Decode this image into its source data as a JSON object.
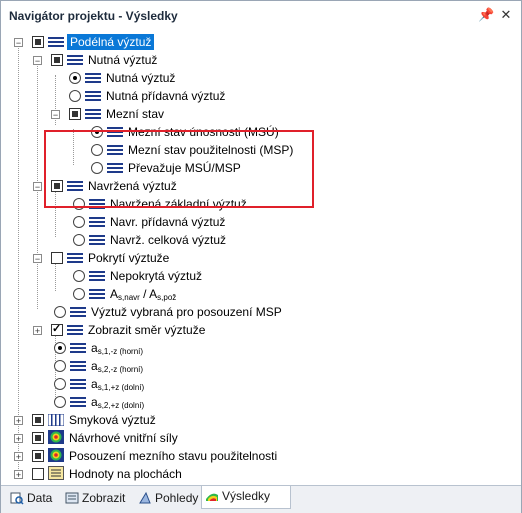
{
  "window": {
    "title": "Navigátor projektu - Výsledky",
    "pin_glyph": "📌",
    "close_glyph": "✕"
  },
  "tree": {
    "root_label": "Podélná výztuž",
    "nutna": {
      "label": "Nutná výztuž",
      "r1": "Nutná výztuž",
      "r2": "Nutná přídavná výztuž"
    },
    "mezni": {
      "label": "Mezní stav",
      "r1": "Mezní stav únosnosti (MSÚ)",
      "r2": "Mezní stav použitelnosti (MSP)",
      "r3": "Převažuje MSÚ/MSP"
    },
    "navrzena": {
      "label": "Navržená výztuž",
      "r1": "Navržená základní výztuž",
      "r2": "Navr. přídavná výztuž",
      "r3": "Navrž. celková výztuž"
    },
    "pokryti": {
      "label": "Pokrytí výztuže",
      "r1": "Nepokrytá výztuž",
      "r2_a": "A",
      "r2_sub1": "s,navr",
      "r2_mid": " / A",
      "r2_sub2": "s,pož"
    },
    "msp": {
      "label": "Výztuž vybraná pro posouzení MSP"
    },
    "smer": {
      "label": "Zobrazit směr výztuže"
    },
    "as": [
      {
        "a": "a",
        "sub": "s,1,-z (horní)"
      },
      {
        "a": "a",
        "sub": "s,2,-z (horní)"
      },
      {
        "a": "a",
        "sub": "s,1,+z (dolní)"
      },
      {
        "a": "a",
        "sub": "s,2,+z (dolní)"
      }
    ],
    "smykova": "Smyková výztuž",
    "navrhove": "Návrhové vnitřní síly",
    "posouzeni": "Posouzení mezního stavu použitelnosti",
    "hodnoty": "Hodnoty na plochách"
  },
  "tabs": [
    {
      "label": "Data",
      "icon": "data-icon"
    },
    {
      "label": "Zobrazit",
      "icon": "display-icon"
    },
    {
      "label": "Pohledy",
      "icon": "views-icon"
    },
    {
      "label": "Výsledky",
      "icon": "results-icon"
    }
  ],
  "colors": {
    "selection": "#0a78d7",
    "highlight_frame": "#e0202a"
  }
}
